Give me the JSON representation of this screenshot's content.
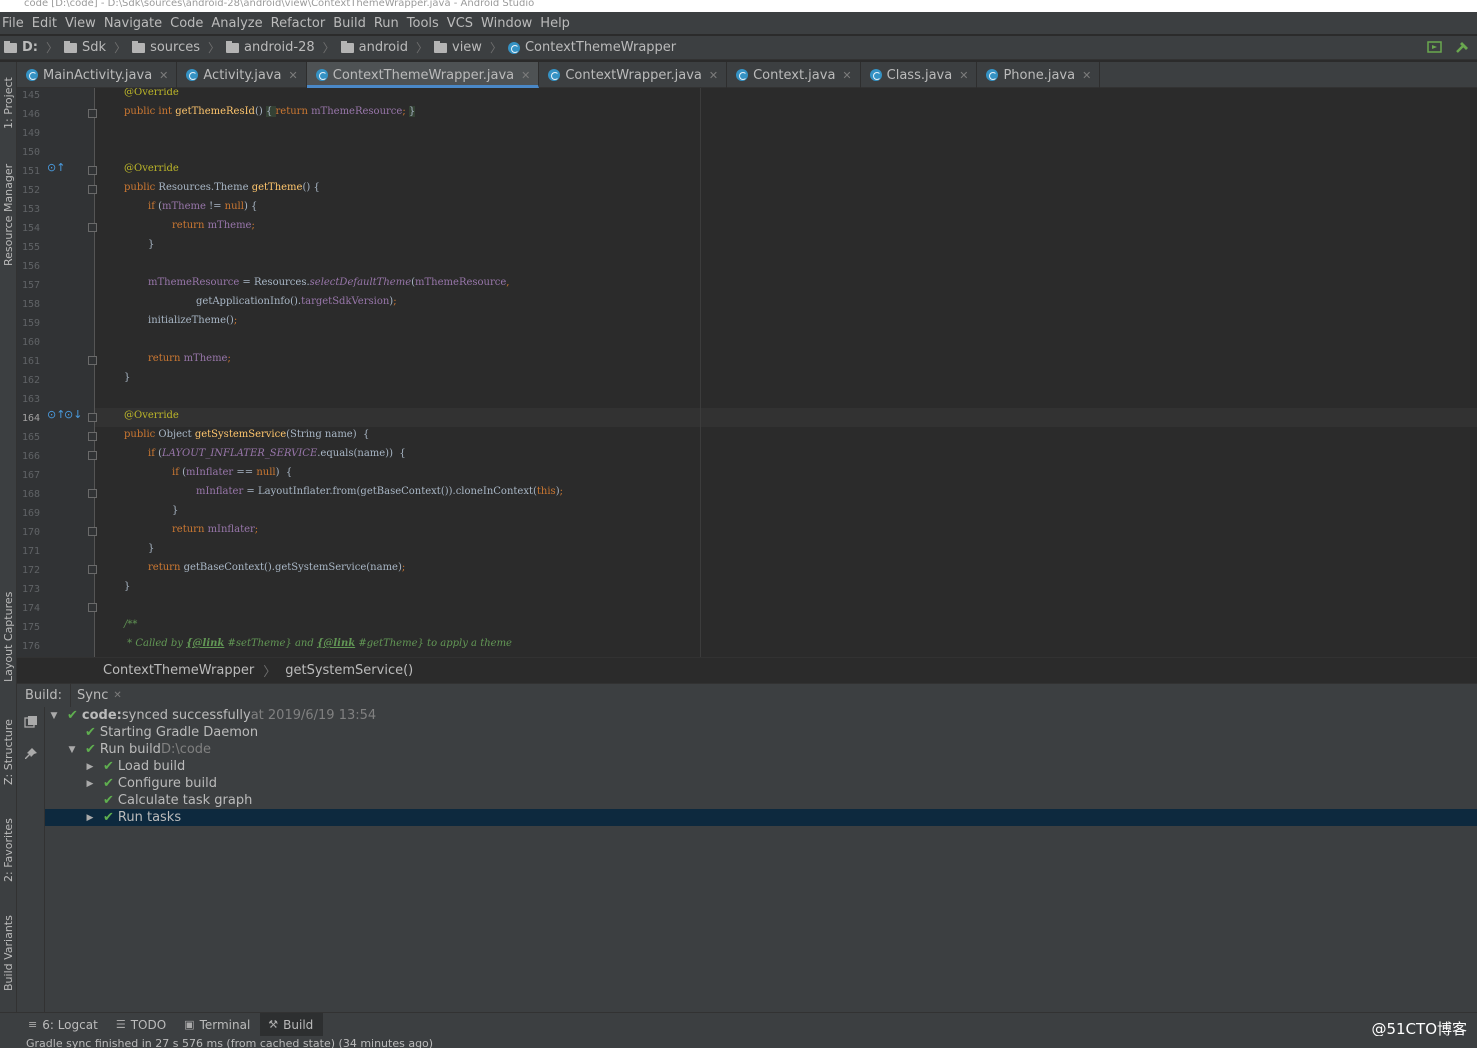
{
  "window": {
    "title": "code [D:\\code] - D:\\Sdk\\sources\\android-28\\android\\view\\ContextThemeWrapper.java - Android Studio"
  },
  "menu": [
    "File",
    "Edit",
    "View",
    "Navigate",
    "Code",
    "Analyze",
    "Refactor",
    "Build",
    "Run",
    "Tools",
    "VCS",
    "Window",
    "Help"
  ],
  "breadcrumb": [
    "D:",
    "Sdk",
    "sources",
    "android-28",
    "android",
    "view",
    "ContextThemeWrapper"
  ],
  "tabs": [
    {
      "label": "MainActivity.java"
    },
    {
      "label": "Activity.java"
    },
    {
      "label": "ContextThemeWrapper.java",
      "active": true
    },
    {
      "label": "ContextWrapper.java"
    },
    {
      "label": "Context.java"
    },
    {
      "label": "Class.java"
    },
    {
      "label": "Phone.java"
    }
  ],
  "left_tool_windows": [
    "1: Project",
    "Resource Manager",
    "Layout Captures",
    "Z: Structure",
    "2: Favorites",
    "Build Variants"
  ],
  "editor": {
    "current_line": "164",
    "lines": [
      {
        "n": "145"
      },
      {
        "n": "146"
      },
      {
        "n": "149"
      },
      {
        "n": "150"
      },
      {
        "n": "151"
      },
      {
        "n": "152"
      },
      {
        "n": "153"
      },
      {
        "n": "154"
      },
      {
        "n": "155"
      },
      {
        "n": "156"
      },
      {
        "n": "157"
      },
      {
        "n": "158"
      },
      {
        "n": "159"
      },
      {
        "n": "160"
      },
      {
        "n": "161"
      },
      {
        "n": "162"
      },
      {
        "n": "163"
      },
      {
        "n": "164"
      },
      {
        "n": "165"
      },
      {
        "n": "166"
      },
      {
        "n": "167"
      },
      {
        "n": "168"
      },
      {
        "n": "169"
      },
      {
        "n": "170"
      },
      {
        "n": "171"
      },
      {
        "n": "172"
      },
      {
        "n": "173"
      },
      {
        "n": "174"
      },
      {
        "n": "175"
      },
      {
        "n": "176"
      }
    ]
  },
  "code_breadcrumb": [
    "ContextThemeWrapper",
    "getSystemService()"
  ],
  "build_panel": {
    "label": "Build:",
    "tab": "Sync",
    "items": [
      {
        "text": "code:",
        "rest": " synced successfully",
        "dim": " at 2019/6/19 13:54",
        "level": 0,
        "expanded": true
      },
      {
        "text": "Starting Gradle Daemon",
        "level": 1
      },
      {
        "text": "Run build",
        "dim": " D:\\code",
        "level": 1,
        "expanded": true
      },
      {
        "text": "Load build",
        "level": 2,
        "collapsed": true
      },
      {
        "text": "Configure build",
        "level": 2,
        "collapsed": true
      },
      {
        "text": "Calculate task graph",
        "level": 2
      },
      {
        "text": "Run tasks",
        "level": 2,
        "collapsed": true,
        "selected": true
      }
    ]
  },
  "bottom_tabs": [
    {
      "label": "6: Logcat",
      "icon": "logcat-icon"
    },
    {
      "label": "TODO",
      "icon": "list-icon"
    },
    {
      "label": "Terminal",
      "icon": "terminal-icon"
    },
    {
      "label": "Build",
      "icon": "hammer-icon",
      "active": true
    }
  ],
  "status": "Gradle sync finished in 27 s 576 ms (from cached state) (34 minutes ago)",
  "watermark": "@51CTO博客"
}
